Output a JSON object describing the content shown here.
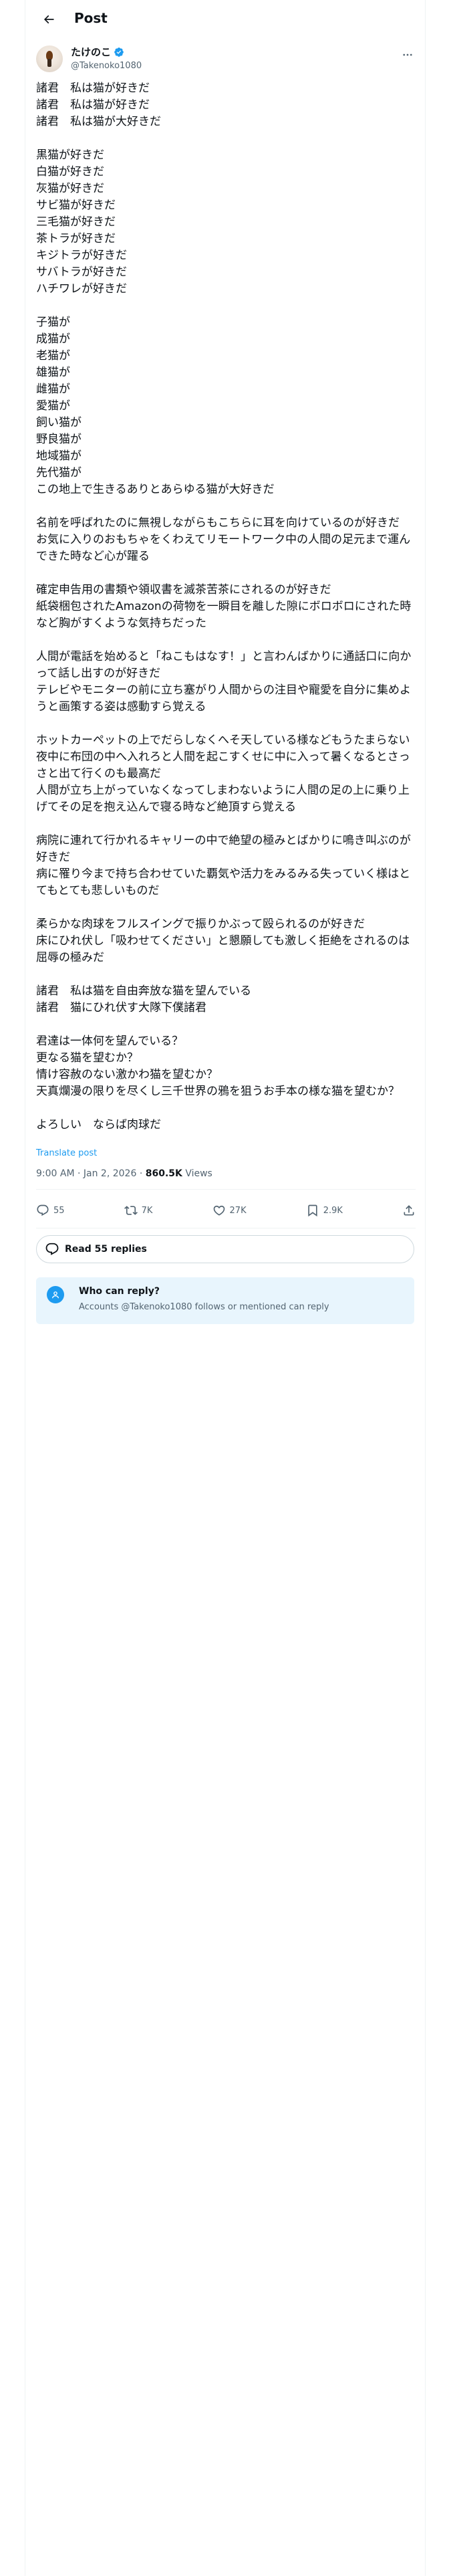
{
  "header": {
    "title": "Post"
  },
  "author": {
    "display_name": "たけのこ",
    "handle": "@Takenoko1080"
  },
  "post": {
    "lines": [
      "諸君　私は猫が好きだ",
      "諸君　私は猫が好きだ",
      "諸君　私は猫が大好きだ",
      "",
      "黒猫が好きだ",
      "白猫が好きだ",
      "灰猫が好きだ",
      "サビ猫が好きだ",
      "三毛猫が好きだ",
      "茶トラが好きだ",
      "キジトラが好きだ",
      "サバトラが好きだ",
      "ハチワレが好きだ",
      "",
      "子猫が",
      "成猫が",
      "老猫が",
      "雄猫が",
      "雌猫が",
      "愛猫が",
      "飼い猫が",
      "野良猫が",
      "地域猫が",
      "先代猫が",
      "この地上で生きるありとあらゆる猫が大好きだ",
      "",
      "名前を呼ばれたのに無視しながらもこちらに耳を向けているのが好きだ",
      "お気に入りのおもちゃをくわえてリモートワーク中の人間の足元まで運んできた時など心が躍る",
      "",
      "確定申告用の書類や領収書を滅茶苦茶にされるのが好きだ",
      "紙袋梱包されたAmazonの荷物を一瞬目を離した隙にボロボロにされた時など胸がすくような気持ちだった",
      "",
      "人間が電話を始めると「ねこもはなす！」と言わんばかりに通話口に向かって話し出すのが好きだ",
      "テレビやモニターの前に立ち塞がり人間からの注目や寵愛を自分に集めようと画策する姿は感動すら覚える",
      "",
      "ホットカーペットの上でだらしなくへそ天している様などもうたまらない",
      "夜中に布団の中へ入れろと人間を起こすくせに中に入って暑くなるとさっさと出て行くのも最高だ",
      "人間が立ち上がっていなくなってしまわないように人間の足の上に乗り上げてその足を抱え込んで寝る時など絶頂すら覚える",
      "",
      "病院に連れて行かれるキャリーの中で絶望の極みとばかりに鳴き叫ぶのが好きだ",
      "病に罹り今まで持ち合わせていた覇気や活力をみるみる失っていく様はとてもとても悲しいものだ",
      "",
      "柔らかな肉球をフルスイングで振りかぶって殴られるのが好きだ",
      "床にひれ伏し「吸わせてください」と懇願しても激しく拒絶をされるのは屈辱の極みだ",
      "",
      "諸君　私は猫を自由奔放な猫を望んでいる",
      "諸君　猫にひれ伏す大隊下僕諸君",
      "",
      "君達は一体何を望んでいる？",
      "更なる猫を望むか？",
      "情け容赦のない激かわ猫を望むか？",
      "天真爛漫の限りを尽くし三千世界の鴉を狙うお手本の様な猫を望むか？",
      "",
      "よろしい　ならば肉球だ"
    ],
    "translate_label": "Translate post",
    "time": "9:00 AM · Jan 2, 2026",
    "views_count": "860.5K",
    "views_label": "Views"
  },
  "actions": {
    "replies": "55",
    "reposts": "7K",
    "likes": "27K",
    "bookmarks": "2.9K"
  },
  "read_replies_label": "Read 55 replies",
  "who_can_reply": {
    "title": "Who can reply?",
    "description": "Accounts @Takenoko1080 follows or mentioned can reply"
  },
  "colors": {
    "accent": "#1d9bf0",
    "text": "#0f1419",
    "muted": "#536471",
    "info_bg": "#e8f5fd"
  }
}
